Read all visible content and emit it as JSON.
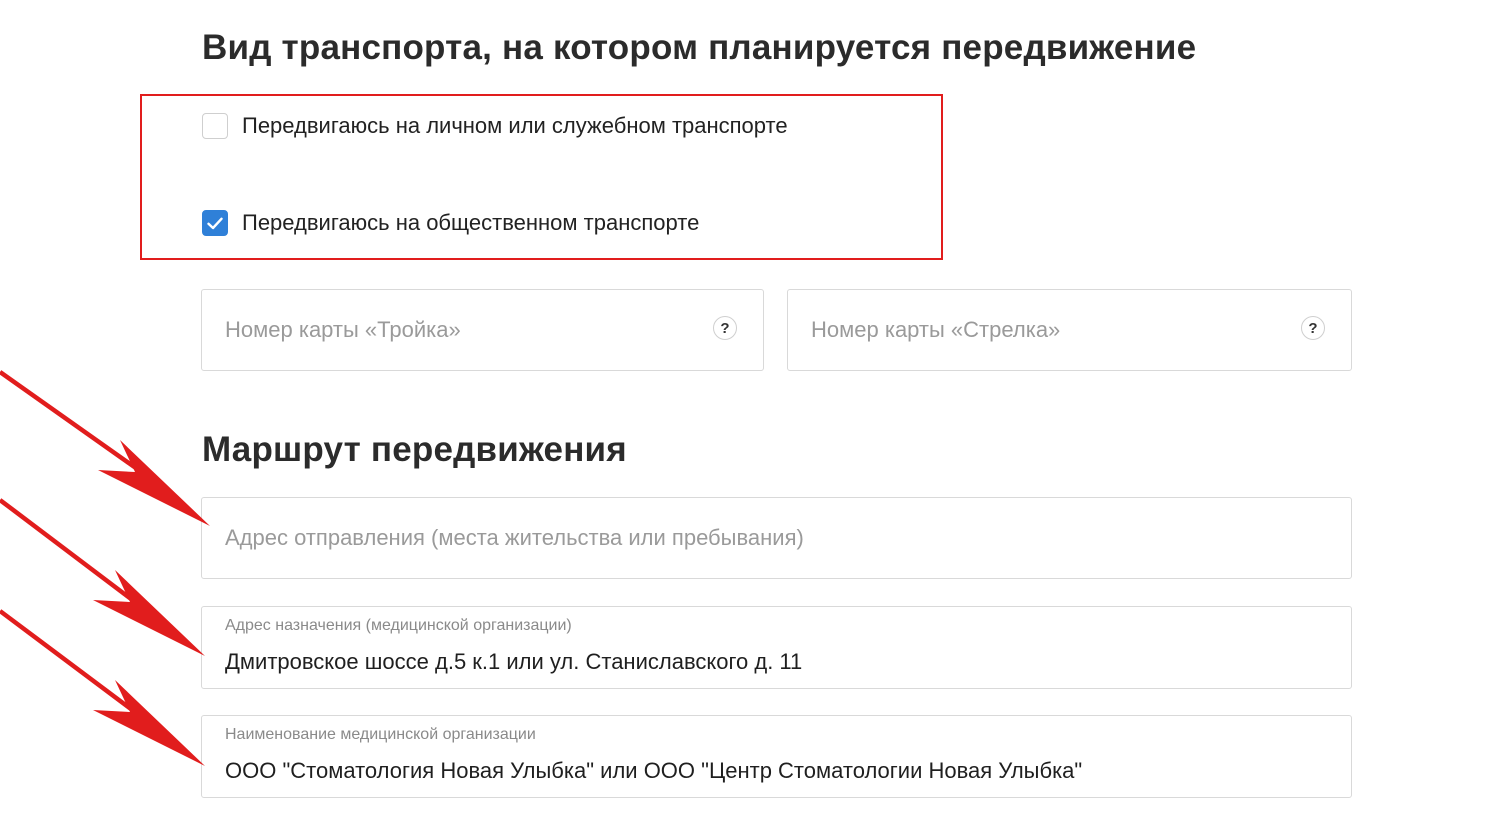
{
  "transport_section": {
    "title": "Вид транспорта, на котором планируется передвижение",
    "options": [
      {
        "label": "Передвигаюсь на личном или служебном транспорте",
        "checked": false
      },
      {
        "label": "Передвигаюсь на общественном транспорте",
        "checked": true
      }
    ],
    "troika_card": {
      "placeholder": "Номер карты «Тройка»",
      "help_icon": "question-icon"
    },
    "strelka_card": {
      "placeholder": "Номер карты «Стрелка»",
      "help_icon": "question-icon"
    }
  },
  "route_section": {
    "title": "Маршрут передвижения",
    "departure": {
      "placeholder": "Адрес отправления (места жительства или пребывания)"
    },
    "destination": {
      "label": "Адрес назначения (медицинской организации)",
      "value": "Дмитровское шоссе д.5 к.1 или ул. Станиславского д. 11"
    },
    "organization": {
      "label": "Наименование медицинской организации",
      "value": "ООО \"Стоматология Новая Улыбка\" или ООО \"Центр Стоматологии Новая Улыбка\""
    }
  },
  "annotations": {
    "highlight_color": "#e11d1d",
    "arrow_color": "#e11d1d",
    "arrow_count": 3
  },
  "colors": {
    "checkbox_checked": "#2f80d8",
    "field_border": "#d9d9d9",
    "placeholder_text": "#9a9a9a"
  }
}
